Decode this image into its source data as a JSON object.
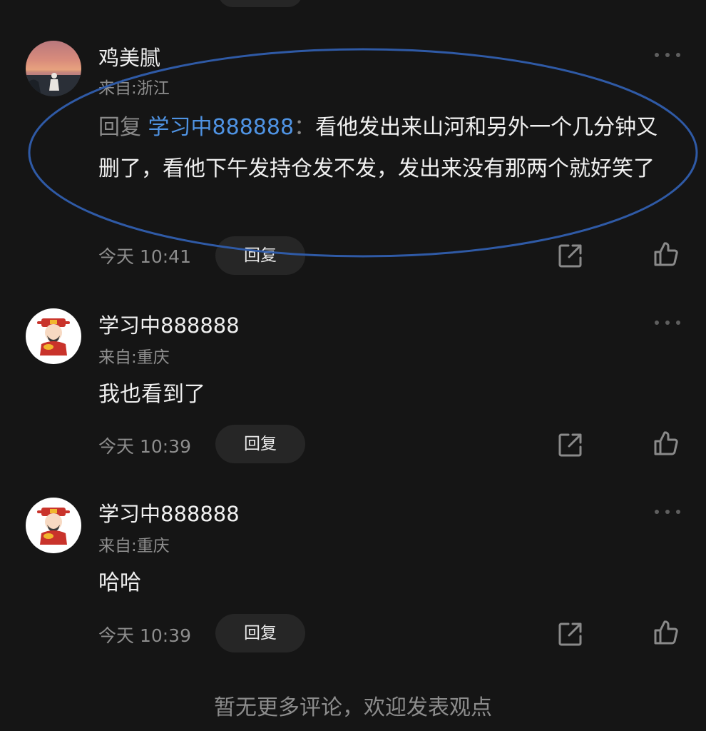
{
  "comments": [
    {
      "username": "鸡美腻",
      "location": "来自:浙江",
      "reply_prefix": "回复",
      "mention": "学习中888888",
      "separator": "：",
      "text": "看他发出来山河和另外一个几分钟又删了，看他下午发持仓发不发，发出来没有那两个就好笑了",
      "time": "今天 10:41",
      "reply_label": "回复",
      "avatar_icon": "sunset-photo-avatar",
      "highlight_color": "#2f5aa6"
    },
    {
      "username": "学习中888888",
      "location": "来自:重庆",
      "text": "我也看到了",
      "time": "今天 10:39",
      "reply_label": "回复",
      "avatar_icon": "god-of-wealth-avatar"
    },
    {
      "username": "学习中888888",
      "location": "来自:重庆",
      "text": "哈哈",
      "time": "今天 10:39",
      "reply_label": "回复",
      "avatar_icon": "god-of-wealth-avatar"
    }
  ],
  "footer": {
    "text": "暂无更多评论，欢迎发表观点"
  }
}
